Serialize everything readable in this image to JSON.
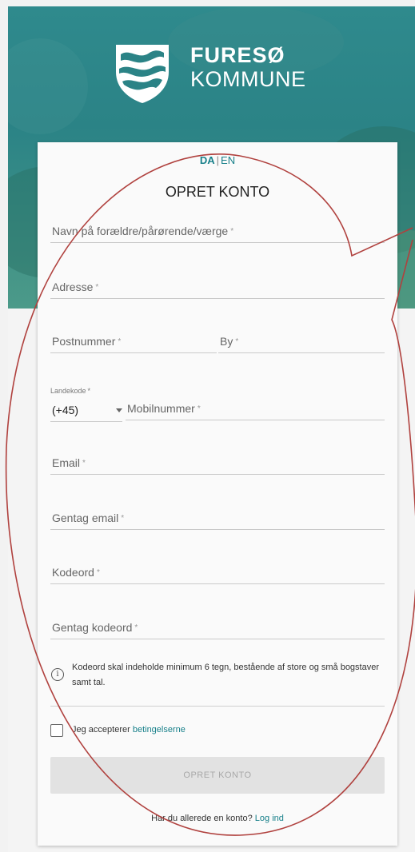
{
  "brand": {
    "line1": "FURESØ",
    "line2": "KOMMUNE"
  },
  "language": {
    "da": "DA",
    "separator": "|",
    "en": "EN"
  },
  "form": {
    "title": "OPRET KONTO",
    "required_mark": "*",
    "fields": {
      "guardian_name": "Navn på forældre/pårørende/værge",
      "address": "Adresse",
      "postal_code": "Postnummer",
      "city": "By",
      "country_code_label": "Landekode",
      "country_code_value": "(+45)",
      "mobile": "Mobilnummer",
      "email": "Email",
      "email_repeat": "Gentag email",
      "password": "Kodeord",
      "password_repeat": "Gentag kodeord"
    },
    "password_hint": "Kodeord skal indeholde minimum 6 tegn, bestående af store og små bogstaver samt tal.",
    "terms_prefix": "Jeg accepterer",
    "terms_link": "betingelserne",
    "submit_label": "OPRET KONTO",
    "login_prompt": "Har du allerede en konto?",
    "login_link": "Log ind"
  },
  "colors": {
    "accent": "#18808a",
    "hero": "#2b8386",
    "annotation": "#b0413e"
  },
  "icons": {
    "logo": "furesoe-shield-icon",
    "info": "info-icon",
    "dropdown": "chevron-down-icon"
  }
}
